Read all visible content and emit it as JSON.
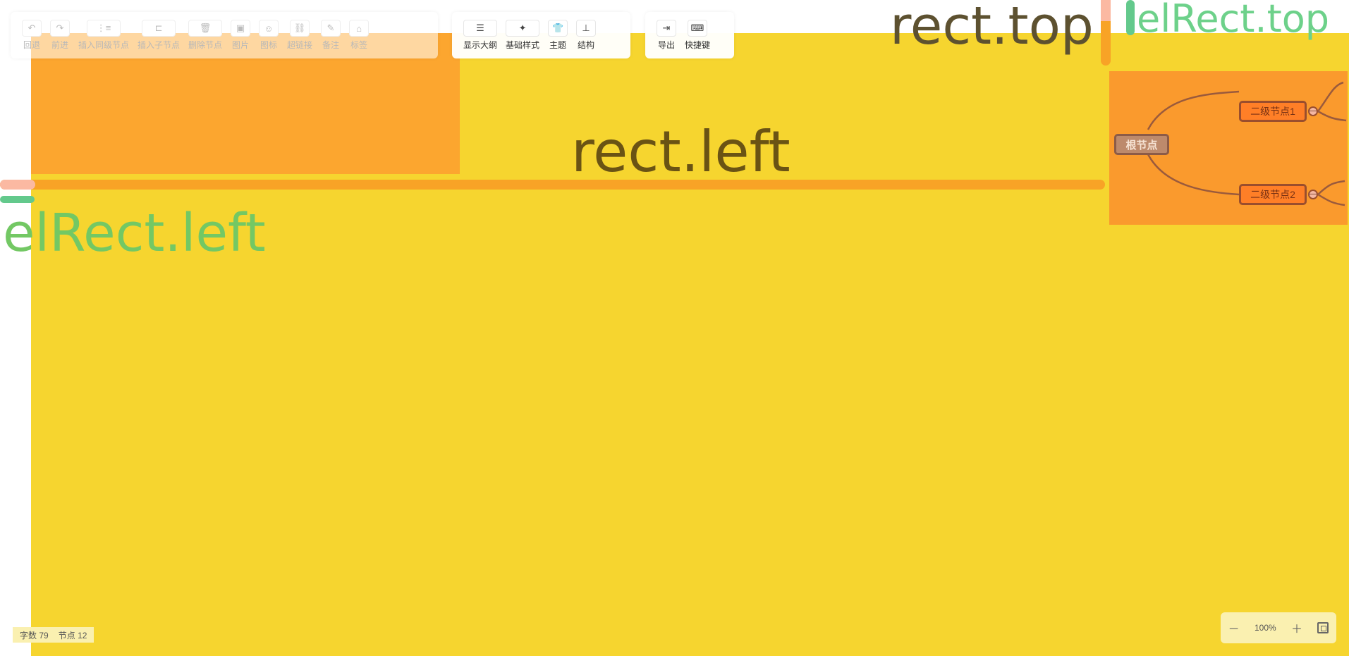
{
  "toolbar": {
    "edit_group": [
      {
        "name": "undo-button",
        "icon": "undo-icon",
        "glyph": "↶",
        "label": "回退",
        "disabled": true
      },
      {
        "name": "redo-button",
        "icon": "redo-icon",
        "glyph": "↷",
        "label": "前进",
        "disabled": true
      },
      {
        "name": "insert-sibling-button",
        "icon": "sibling-node-icon",
        "glyph": "⋮≡",
        "label": "插入同级节点",
        "disabled": true,
        "wide": true
      },
      {
        "name": "insert-child-button",
        "icon": "child-node-icon",
        "glyph": "⊏",
        "label": "插入子节点",
        "disabled": true,
        "wide": true
      },
      {
        "name": "delete-node-button",
        "icon": "trash-icon",
        "glyph": "🗑",
        "label": "删除节点",
        "disabled": true,
        "wide": true
      },
      {
        "name": "image-button",
        "icon": "image-icon",
        "glyph": "▣",
        "label": "图片",
        "disabled": true
      },
      {
        "name": "emoji-icon-button",
        "icon": "smiley-icon",
        "glyph": "☺",
        "label": "图标",
        "disabled": true
      },
      {
        "name": "hyperlink-button",
        "icon": "link-icon",
        "glyph": "⛓",
        "label": "超链接",
        "disabled": true
      },
      {
        "name": "note-button",
        "icon": "note-icon",
        "glyph": "✎",
        "label": "备注",
        "disabled": true
      },
      {
        "name": "tag-button",
        "icon": "tag-icon",
        "glyph": "⌂",
        "label": "标签",
        "disabled": true
      }
    ],
    "view_group": [
      {
        "name": "show-outline-button",
        "icon": "outline-icon",
        "glyph": "☰",
        "label": "显示大纲",
        "wide": true
      },
      {
        "name": "base-style-button",
        "icon": "magic-wand-icon",
        "glyph": "✦",
        "label": "基础样式",
        "wide": true
      },
      {
        "name": "theme-button",
        "icon": "shirt-icon",
        "glyph": "👕",
        "label": "主题"
      },
      {
        "name": "structure-button",
        "icon": "hierarchy-icon",
        "glyph": "⊥",
        "label": "结构"
      }
    ],
    "file_group": [
      {
        "name": "export-button",
        "icon": "export-icon",
        "glyph": "⇥",
        "label": "导出"
      },
      {
        "name": "shortcuts-button",
        "icon": "keyboard-icon",
        "glyph": "⌨",
        "label": "快捷键"
      }
    ]
  },
  "overlay_labels": {
    "rect_top": "rect.top",
    "elrect_top": "elRect.top",
    "rect_left": "rect.left",
    "elrect_left": "elRect.left"
  },
  "mindmap": {
    "root": "根节点",
    "children": [
      "二级节点1",
      "二级节点2"
    ],
    "collapse_glyph": "—"
  },
  "status": {
    "word_count_label": "字数",
    "word_count": "79",
    "node_count_label": "节点",
    "node_count": "12"
  },
  "zoom": {
    "minus": "－",
    "level": "100%",
    "plus": "＋"
  },
  "colors": {
    "el_rect": "#f6d52f",
    "rect_marker": "#f8a326",
    "elrect_marker": "#63c98c",
    "mindmap_bg": "#fa9a2d"
  }
}
